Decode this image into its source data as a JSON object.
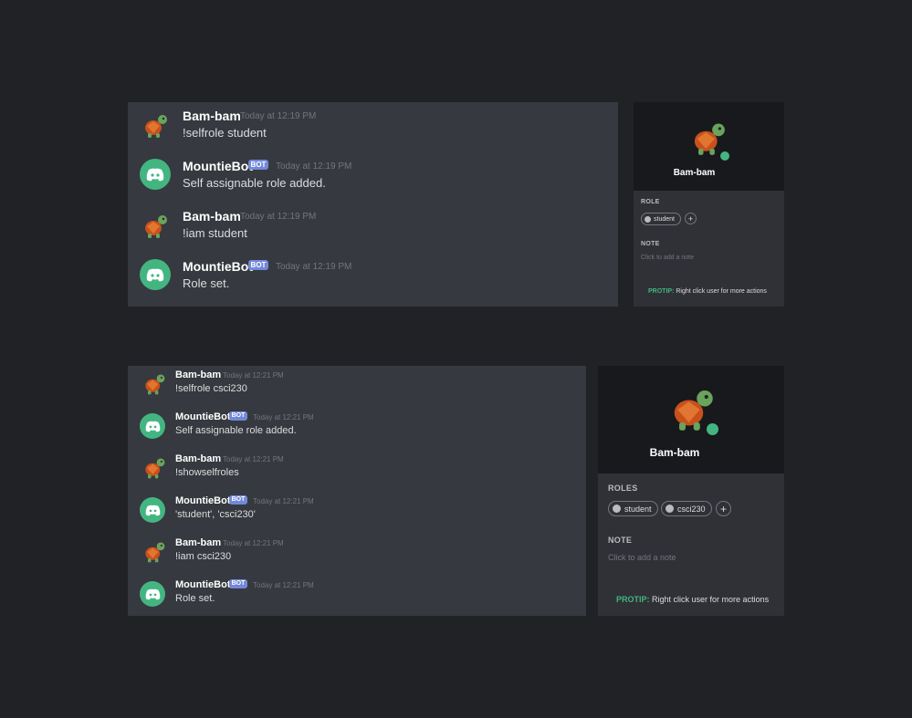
{
  "colors": {
    "page_bg": "#202225",
    "chat_bg": "#36393f",
    "profile_bg": "#18191c",
    "panel_bg": "#2f3136",
    "bot_avatar": "#43b581",
    "bot_tag": "#7289da",
    "protip": "#43b581",
    "online": "#43b581"
  },
  "top": {
    "messages": [
      {
        "author": "Bam-bam",
        "time": "Today at 12:19 PM",
        "text": "!selfrole student",
        "avatar": "turtle-avatar-icon",
        "bot": false
      },
      {
        "author": "MountieBot",
        "time": "Today at 12:19 PM",
        "text": "Self assignable role added.",
        "avatar": "discord-logo-icon",
        "bot": true,
        "tag": "BOT"
      },
      {
        "author": "Bam-bam",
        "time": "Today at 12:19 PM",
        "text": "!iam student",
        "avatar": "turtle-avatar-icon",
        "bot": false
      },
      {
        "author": "MountieBot",
        "time": "Today at 12:19 PM",
        "text": "Role set.",
        "avatar": "discord-logo-icon",
        "bot": true,
        "tag": "BOT"
      }
    ],
    "profile": {
      "name": "Bam-bam",
      "roles_heading": "ROLE",
      "roles": [
        "student"
      ],
      "add": "+",
      "note_heading": "NOTE",
      "note_placeholder": "Click to add a note",
      "protip_label": "PROTIP:",
      "protip_text": "Right click user for more actions"
    }
  },
  "bottom": {
    "messages": [
      {
        "author": "Bam-bam",
        "time": "Today at 12:21 PM",
        "text": "!selfrole csci230",
        "avatar": "turtle-avatar-icon",
        "bot": false
      },
      {
        "author": "MountieBot",
        "time": "Today at 12:21 PM",
        "text": "Self assignable role added.",
        "avatar": "discord-logo-icon",
        "bot": true,
        "tag": "BOT"
      },
      {
        "author": "Bam-bam",
        "time": "Today at 12:21 PM",
        "text": "!showselfroles",
        "avatar": "turtle-avatar-icon",
        "bot": false
      },
      {
        "author": "MountieBot",
        "time": "Today at 12:21 PM",
        "text": "'student', 'csci230'",
        "avatar": "discord-logo-icon",
        "bot": true,
        "tag": "BOT"
      },
      {
        "author": "Bam-bam",
        "time": "Today at 12:21 PM",
        "text": "!iam csci230",
        "avatar": "turtle-avatar-icon",
        "bot": false
      },
      {
        "author": "MountieBot",
        "time": "Today at 12:21 PM",
        "text": "Role set.",
        "avatar": "discord-logo-icon",
        "bot": true,
        "tag": "BOT"
      }
    ],
    "profile": {
      "name": "Bam-bam",
      "roles_heading": "ROLES",
      "roles": [
        "student",
        "csci230"
      ],
      "add": "+",
      "note_heading": "NOTE",
      "note_placeholder": "Click to add a note",
      "protip_label": "PROTIP:",
      "protip_text": "Right click user for more actions"
    }
  }
}
